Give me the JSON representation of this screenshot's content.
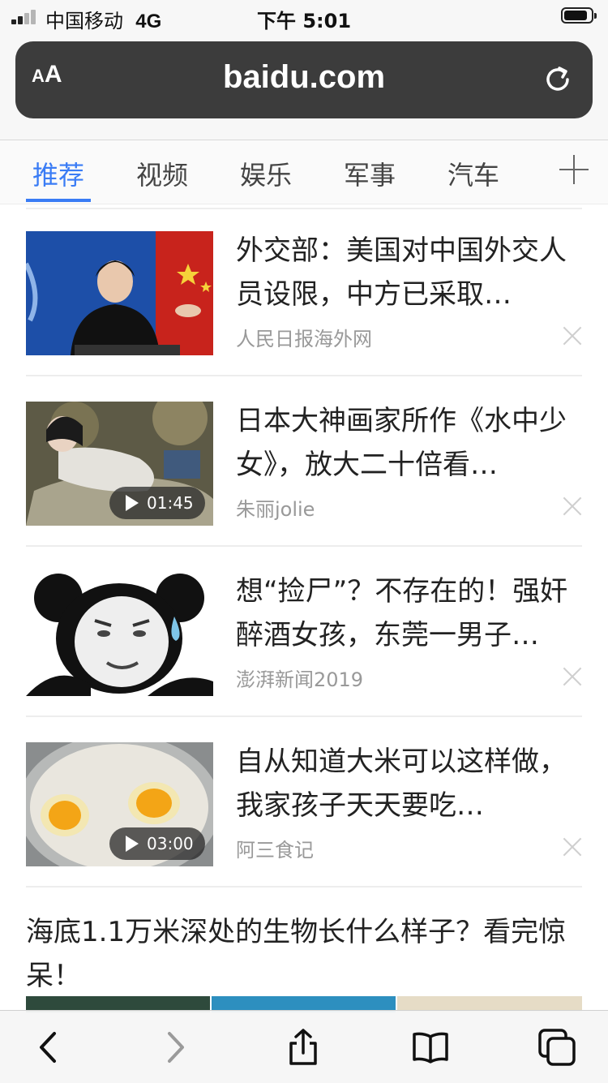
{
  "status_bar": {
    "carrier": "中国移动",
    "network": "4G",
    "time": "下午 5:01"
  },
  "url_bar": {
    "text_size_small": "A",
    "text_size_large": "A",
    "domain": "baidu.com",
    "reload_icon": "reload-icon"
  },
  "tabs": [
    {
      "label": "推荐",
      "active": true
    },
    {
      "label": "视频",
      "active": false
    },
    {
      "label": "娱乐",
      "active": false
    },
    {
      "label": "军事",
      "active": false
    },
    {
      "label": "汽车",
      "active": false
    }
  ],
  "feed": [
    {
      "title": "外交部：美国对中国外交人员设限，中方已采取…",
      "source": "人民日报海外网",
      "duration": ""
    },
    {
      "title": "日本大神画家所作《水中少女》，放大二十倍看…",
      "source": "朱丽jolie",
      "duration": "01:45"
    },
    {
      "title": "想“捡尸”？不存在的！强奸醉酒女孩，东莞一男子…",
      "source": "澎湃新闻2019",
      "duration": ""
    },
    {
      "title": "自从知道大米可以这样做，我家孩子天天要吃…",
      "source": "阿三食记",
      "duration": "03:00"
    }
  ],
  "big_item": {
    "title": "海底1.1万米深处的生物长什么样子？看完惊呆！"
  },
  "colors": {
    "accent": "#3a7cf5",
    "url_bar": "#3c3c3c"
  },
  "toolbar": {
    "icons": [
      "back-icon",
      "forward-icon",
      "share-icon",
      "bookmarks-icon",
      "tabs-icon"
    ]
  }
}
